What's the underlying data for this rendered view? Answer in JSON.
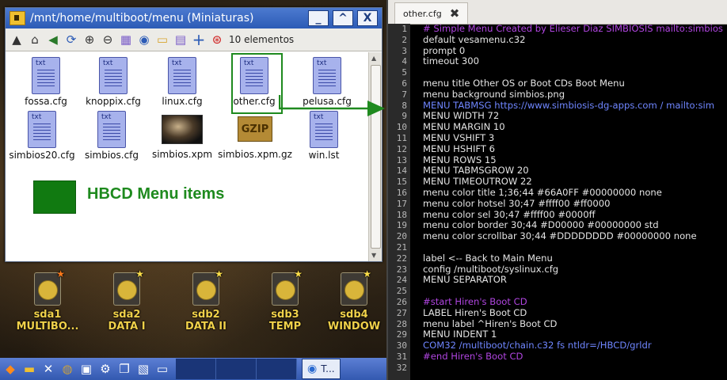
{
  "file_manager": {
    "title": "/mnt/home/multiboot/menu (Miniaturas)",
    "window_buttons": [
      "_",
      "^",
      "X"
    ],
    "item_count": "10 elementos",
    "files": [
      {
        "name": "fossa.cfg",
        "type": "txt"
      },
      {
        "name": "knoppix.cfg",
        "type": "txt"
      },
      {
        "name": "linux.cfg",
        "type": "txt"
      },
      {
        "name": "other.cfg",
        "type": "txt",
        "selected": true
      },
      {
        "name": "pelusa.cfg",
        "type": "txt"
      },
      {
        "name": "simbios20.cfg",
        "type": "txt"
      },
      {
        "name": "simbios.cfg",
        "type": "txt"
      },
      {
        "name": "simbios.xpm",
        "type": "image"
      },
      {
        "name": "simbios.xpm.gz",
        "type": "gzip"
      },
      {
        "name": "win.lst",
        "type": "txt"
      }
    ],
    "txt_tag": "txt",
    "gzip_tag": "GZIP",
    "annotation": "HBCD Menu items"
  },
  "drives": [
    {
      "device": "sda1",
      "label": "MULTIBO...",
      "star_color": "#ff7a1a"
    },
    {
      "device": "sda2",
      "label": "DATA I",
      "star_color": "#ffe04a"
    },
    {
      "device": "sdb2",
      "label": "DATA II",
      "star_color": "#ffe04a"
    },
    {
      "device": "sdb3",
      "label": "TEMP",
      "star_color": "#ffe04a"
    },
    {
      "device": "sdb4",
      "label": "WINDOW",
      "star_color": "#ffe04a"
    }
  ],
  "taskbar": {
    "firefox_label": "T..."
  },
  "editor": {
    "tab_label": "other.cfg",
    "close_glyph": "✖",
    "lines": [
      {
        "n": "1",
        "text": "# Simple Menu Created by Elieser Diaz SIMBIOSIS mailto:simbios",
        "style": "comment"
      },
      {
        "n": "2",
        "text": "default vesamenu.c32",
        "style": "normal"
      },
      {
        "n": "3",
        "text": "prompt 0",
        "style": "normal"
      },
      {
        "n": "4",
        "text": "timeout 300",
        "style": "normal"
      },
      {
        "n": "5",
        "text": "",
        "style": "normal"
      },
      {
        "n": "6",
        "text": "menu title Other OS or Boot CDs Boot Menu",
        "style": "normal"
      },
      {
        "n": "7",
        "text": "menu background simbios.png",
        "style": "normal"
      },
      {
        "n": "8",
        "text": "MENU TABMSG https://www.simbiosis-dg-apps.com / mailto:sim",
        "style": "keyword"
      },
      {
        "n": "9",
        "text": "MENU WIDTH 72",
        "style": "normal"
      },
      {
        "n": "10",
        "text": "MENU MARGIN 10",
        "style": "normal"
      },
      {
        "n": "11",
        "text": "MENU VSHIFT 3",
        "style": "normal"
      },
      {
        "n": "12",
        "text": "MENU HSHIFT 6",
        "style": "normal"
      },
      {
        "n": "13",
        "text": "MENU ROWS 15",
        "style": "normal"
      },
      {
        "n": "14",
        "text": "MENU TABMSGROW 20",
        "style": "normal"
      },
      {
        "n": "15",
        "text": "MENU TIMEOUTROW 22",
        "style": "normal"
      },
      {
        "n": "16",
        "text": "menu color title 1;36;44 #66A0FF #00000000 none",
        "style": "normal"
      },
      {
        "n": "17",
        "text": "menu color hotsel 30;47 #ffff00 #ff0000",
        "style": "normal"
      },
      {
        "n": "18",
        "text": "menu color sel 30;47 #ffff00 #0000ff",
        "style": "normal"
      },
      {
        "n": "19",
        "text": "menu color border 30;44 #D00000 #00000000 std",
        "style": "normal"
      },
      {
        "n": "20",
        "text": "menu color scrollbar 30;44 #DDDDDDDD #00000000 none",
        "style": "normal"
      },
      {
        "n": "21",
        "text": "",
        "style": "normal"
      },
      {
        "n": "22",
        "text": "label <-- Back to Main Menu",
        "style": "normal"
      },
      {
        "n": "23",
        "text": "config /multiboot/syslinux.cfg",
        "style": "normal"
      },
      {
        "n": "24",
        "text": "MENU SEPARATOR",
        "style": "normal"
      },
      {
        "n": "25",
        "text": "",
        "style": "normal"
      },
      {
        "n": "26",
        "text": "#start Hiren's Boot CD",
        "style": "comment"
      },
      {
        "n": "27",
        "text": "LABEL Hiren's Boot CD",
        "style": "normal"
      },
      {
        "n": "28",
        "text": "menu label ^Hiren's Boot CD",
        "style": "normal"
      },
      {
        "n": "29",
        "text": "MENU INDENT 1",
        "style": "normal"
      },
      {
        "n": "30",
        "text": "COM32 /multiboot/chain.c32 fs ntldr=/HBCD/grldr",
        "style": "keyword"
      },
      {
        "n": "31",
        "text": "#end Hiren's Boot CD",
        "style": "comment"
      },
      {
        "n": "32",
        "text": "",
        "style": "normal"
      }
    ]
  }
}
